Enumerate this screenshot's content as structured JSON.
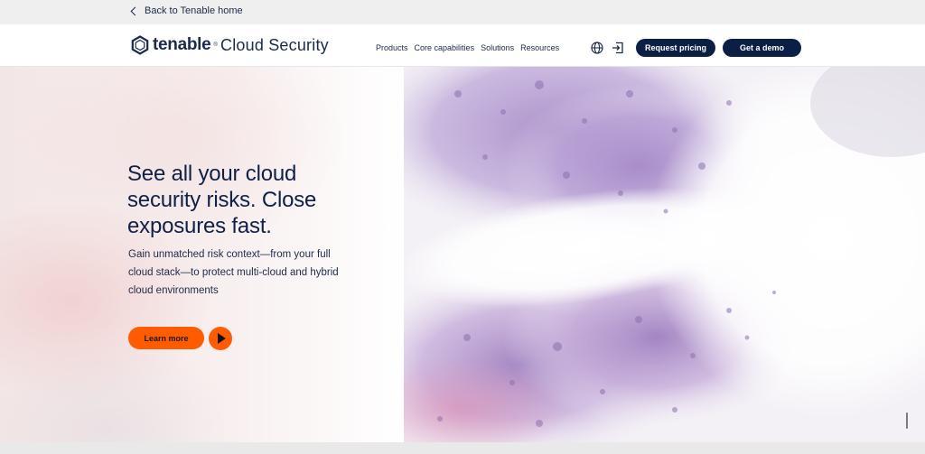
{
  "topbar": {
    "back_label": "Back to Tenable home"
  },
  "header": {
    "logo_text": "tenable",
    "logo_mark": "®",
    "product_name": "Cloud Security",
    "nav": [
      "Products",
      "Core capabilities",
      "Solutions",
      "Resources"
    ],
    "icons": {
      "language": "globe-icon",
      "login": "login-icon"
    },
    "pricing_label": "Request pricing",
    "demo_label": "Get a demo"
  },
  "hero": {
    "headline": "See all your cloud security risks. Close exposures fast.",
    "subtext": "Gain unmatched risk context—from your full cloud stack—to protect multi-cloud and hybrid cloud environments",
    "learn_label": "Learn more"
  },
  "colors": {
    "navy": "#0b1f45",
    "accent": "#ff5b00"
  }
}
